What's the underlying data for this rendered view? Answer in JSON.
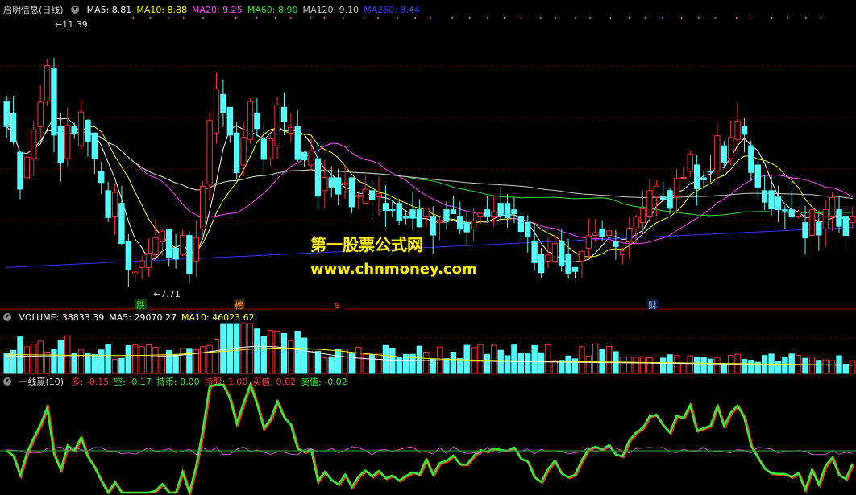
{
  "main_panel": {
    "stock_title": "启明信息(日线)",
    "ma": [
      {
        "label": "MA5: 8.81",
        "color": "#ffffff"
      },
      {
        "label": "MA10: 8.88",
        "color": "#ffff00"
      },
      {
        "label": "MA20: 9.25",
        "color": "#ff44ff"
      },
      {
        "label": "MA60: 8.90",
        "color": "#33dd33"
      },
      {
        "label": "MA120: 9.10",
        "color": "#cccccc"
      },
      {
        "label": "MA250: 8.44",
        "color": "#3333ff"
      }
    ],
    "high_label": "11.39",
    "low_label": "7.71",
    "events": [
      {
        "label": "跌",
        "color": "#33cc33",
        "bg": "#0a3a0a"
      },
      {
        "label": "榜",
        "color": "#ff9933",
        "bg": "#3a2000"
      },
      {
        "label": "$",
        "color": "#ff3333",
        "bg": "#000000"
      },
      {
        "label": "财",
        "color": "#88ccff",
        "bg": "#0a1a3a"
      }
    ]
  },
  "watermark": {
    "line1": "第一股票公式网",
    "line2": "www.chnmoney.com"
  },
  "volume_panel": {
    "items": [
      {
        "label": "VOLUME: 38833.39",
        "color": "#ffffff"
      },
      {
        "label": "MA5: 29070.27",
        "color": "#ffffff"
      },
      {
        "label": "MA10: 46023.62",
        "color": "#ffff00"
      }
    ]
  },
  "indicator_panel": {
    "name": "一线赢(10)",
    "items": [
      {
        "label": "多: -0.15",
        "color": "#ff3333"
      },
      {
        "label": "空: -0.17",
        "color": "#33ee33"
      },
      {
        "label": "持币: 0.00",
        "color": "#33ee33"
      },
      {
        "label": "持股: 1.00",
        "color": "#ff3333"
      },
      {
        "label": "买值: 0.02",
        "color": "#ff3333"
      },
      {
        "label": "卖值: -0.02",
        "color": "#33ee33"
      }
    ]
  },
  "chart_data": {
    "type": "candlestick",
    "ylim": [
      7.3,
      11.8
    ],
    "bar_count": 126,
    "candles_start": [
      10.5,
      10.3,
      9.7,
      9.3,
      9.6,
      10.1,
      10.5,
      11.0,
      10.1,
      9.6,
      10.1,
      9.8,
      10.2,
      10.0,
      9.4,
      9.1,
      8.7,
      8.9,
      8.3,
      7.8,
      7.9,
      7.9,
      8.1,
      8.3,
      8.5,
      8.2,
      8.1,
      8.4,
      8.0,
      8.5,
      9.2,
      10.0,
      10.6,
      10.4,
      10.0,
      9.5,
      9.9,
      10.3,
      9.9,
      9.6,
      9.8,
      10.4,
      10.0,
      10.1,
      9.7,
      9.5,
      9.6,
      9.1,
      9.3,
      9.3,
      9.2,
      9.3,
      9.0,
      8.9,
      9.1,
      9.0,
      8.9,
      8.8,
      8.9,
      8.7,
      8.8,
      8.8,
      8.7,
      8.7,
      8.6,
      8.8,
      8.8,
      8.7,
      8.6,
      8.5,
      8.7,
      8.8,
      8.7,
      8.9,
      8.9,
      8.8,
      8.7,
      8.6,
      8.3,
      8.1,
      8.0,
      8.0,
      8.3,
      8.1,
      7.9,
      8.0,
      8.2,
      8.4,
      8.5,
      8.4,
      8.3,
      8.1,
      8.3,
      8.5,
      8.6,
      8.7,
      9.0,
      9.0,
      9.1,
      9.0,
      9.3,
      9.4,
      9.5,
      9.3,
      9.4,
      9.4,
      9.8,
      9.6,
      9.9,
      10.1,
      9.8,
      9.5,
      9.1,
      9.1,
      9.0,
      8.8,
      8.8,
      8.7,
      8.6,
      8.4,
      8.6,
      8.5,
      8.7,
      8.8,
      8.7,
      8.6
    ],
    "volume_ylim": [
      0,
      100
    ]
  }
}
